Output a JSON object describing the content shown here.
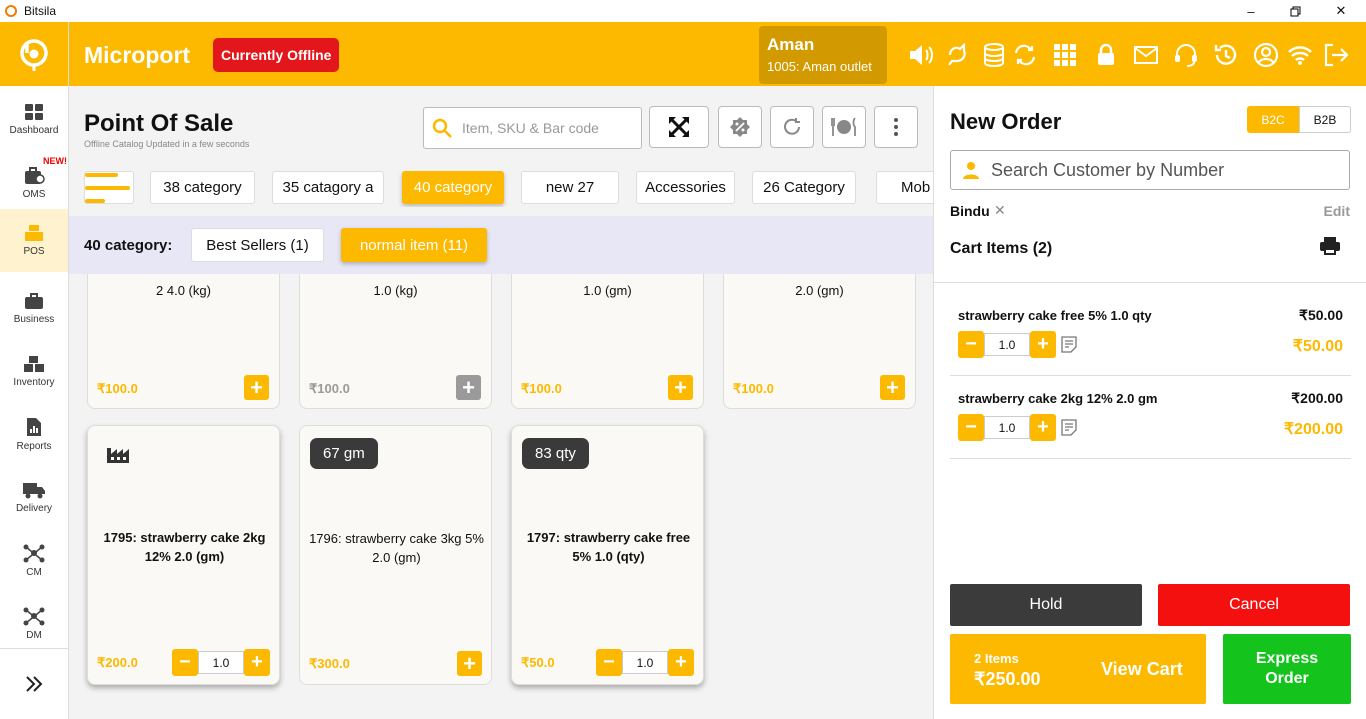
{
  "window": {
    "title": "Bitsila"
  },
  "sidebar": {
    "new_badge": "NEW!",
    "items": [
      {
        "label": "Dashboard",
        "icon": "dashboard-icon"
      },
      {
        "label": "OMS",
        "icon": "oms-icon"
      },
      {
        "label": "POS",
        "icon": "pos-icon"
      },
      {
        "label": "Business",
        "icon": "briefcase-icon"
      },
      {
        "label": "Inventory",
        "icon": "boxes-icon"
      },
      {
        "label": "Reports",
        "icon": "report-icon"
      },
      {
        "label": "Delivery",
        "icon": "truck-icon"
      },
      {
        "label": "CM",
        "icon": "network-icon"
      },
      {
        "label": "DM",
        "icon": "network-icon"
      }
    ]
  },
  "header": {
    "brand": "Microport",
    "status": "Currently Offline",
    "user_name": "Aman",
    "outlet": "1005: Aman outlet"
  },
  "pos": {
    "title": "Point Of Sale",
    "subtitle": "Offline Catalog Updated in a few seconds",
    "search_placeholder": "Item, SKU & Bar code",
    "categories": [
      "38 category",
      "35 catagory a",
      "40 category",
      "new 27",
      "Accessories",
      "26 Category",
      "Mob"
    ],
    "active_category": "40 category",
    "sub_label": "40 category:",
    "subcategories": [
      "Best Sellers (1)",
      "normal item (11)"
    ]
  },
  "products_top": [
    {
      "qty": "2 4.0 (kg)",
      "price": "₹100.0"
    },
    {
      "qty": "1.0 (kg)",
      "price": "₹100.0"
    },
    {
      "qty": "1.0 (gm)",
      "price": "₹100.0"
    },
    {
      "qty": "2.0 (gm)",
      "price": "₹100.0"
    }
  ],
  "products": [
    {
      "name": "1795: strawberry cake 2kg 12% 2.0 (gm)",
      "price": "₹200.0",
      "stepper": "1.0"
    },
    {
      "badge": "67 gm",
      "name": "1796: strawberry cake 3kg 5% 2.0 (gm)",
      "price": "₹300.0"
    },
    {
      "badge": "83 qty",
      "name": "1797: strawberry cake free 5% 1.0 (qty)",
      "price": "₹50.0",
      "stepper": "1.0"
    }
  ],
  "order": {
    "title": "New Order",
    "b2c": "B2C",
    "b2b": "B2B",
    "customer_search_placeholder": "Search Customer by Number",
    "customer": "Bindu",
    "edit": "Edit",
    "cart_title": "Cart Items (2)",
    "items": [
      {
        "name": "strawberry cake free 5% 1.0 qty",
        "unit_price": "₹50.00",
        "qty": "1.0",
        "total": "₹50.00"
      },
      {
        "name": "strawberry cake 2kg 12% 2.0 gm",
        "unit_price": "₹200.00",
        "qty": "1.0",
        "total": "₹200.00"
      }
    ],
    "hold": "Hold",
    "cancel": "Cancel",
    "item_count": "2 Items",
    "total": "₹250.00",
    "view_cart": "View Cart",
    "express": "Express Order"
  },
  "colors": {
    "accent": "#fcb900",
    "danger": "#f51010",
    "success": "#14c41c",
    "dark": "#3b3b3b"
  }
}
